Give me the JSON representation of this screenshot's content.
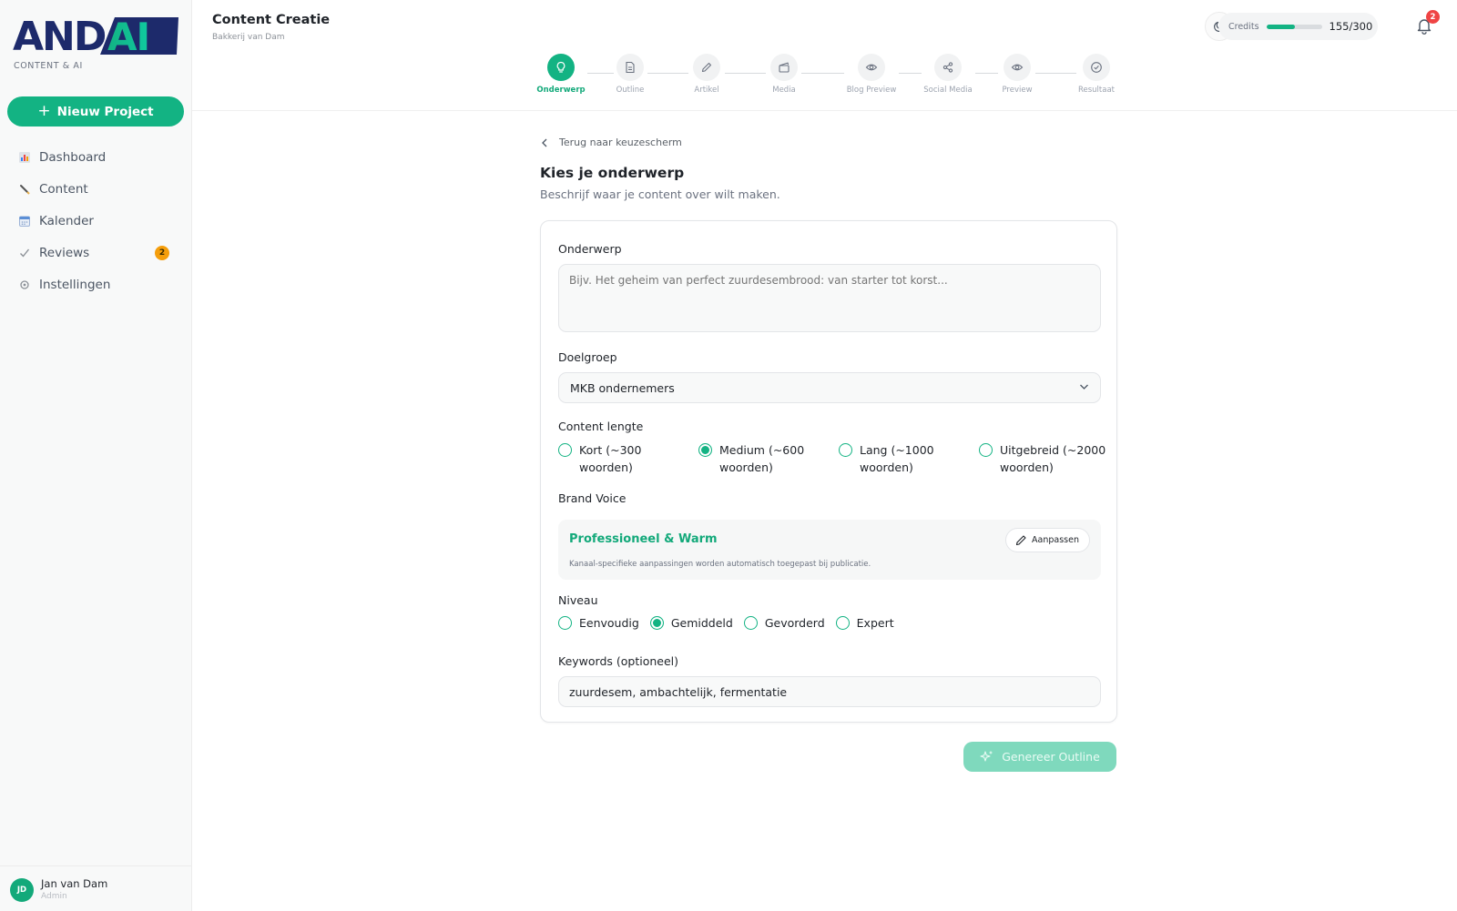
{
  "brand": {
    "logo_text": "ANDAI",
    "tagline": "CONTENT & AI",
    "accent": "#13b383"
  },
  "sidebar": {
    "new_project": "Nieuw Project",
    "items": [
      {
        "label": "Dashboard",
        "icon": "chart-icon"
      },
      {
        "label": "Content",
        "icon": "pencil-icon"
      },
      {
        "label": "Kalender",
        "icon": "calendar-icon"
      },
      {
        "label": "Reviews",
        "icon": "check-icon",
        "badge": "2"
      },
      {
        "label": "Instellingen",
        "icon": "gear-icon"
      }
    ],
    "user": {
      "initials": "JD",
      "name": "Jan van Dam",
      "role": "Admin"
    }
  },
  "header": {
    "title": "Content Creatie",
    "subtitle": "Bakkerij van Dam",
    "credits_label": "Credits",
    "credits_value": "155/300",
    "credits_fraction": 0.52,
    "notifications": "2"
  },
  "stepper": {
    "steps": [
      {
        "label": "Onderwerp",
        "icon": "lightbulb-icon",
        "active": true
      },
      {
        "label": "Outline",
        "icon": "document-icon"
      },
      {
        "label": "Artikel",
        "icon": "pen-icon"
      },
      {
        "label": "Media",
        "icon": "film-icon"
      },
      {
        "label": "Blog Preview",
        "icon": "eye-icon"
      },
      {
        "label": "Social Media",
        "icon": "share-icon"
      },
      {
        "label": "Preview",
        "icon": "eye-icon"
      },
      {
        "label": "Resultaat",
        "icon": "check-circle-icon"
      }
    ]
  },
  "main": {
    "back": "Terug naar keuzescherm",
    "title": "Kies je onderwerp",
    "subtitle": "Beschrijf waar je content over wilt maken.",
    "topic_label": "Onderwerp",
    "topic_placeholder": "Bijv. Het geheim van perfect zuurdesembrood: van starter tot korst...",
    "audience_label": "Doelgroep",
    "audience_value": "MKB ondernemers",
    "length_label": "Content lengte",
    "length_options": [
      {
        "line1": "Kort (~300",
        "line2": "woorden)"
      },
      {
        "line1": "Medium (~600",
        "line2": "woorden)",
        "checked": true
      },
      {
        "line1": "Lang (~1000",
        "line2": "woorden)"
      },
      {
        "line1": "Uitgebreid (~2000",
        "line2": "woorden)"
      }
    ],
    "voice_label": "Brand Voice",
    "voice_name": "Professioneel & Warm",
    "voice_edit": "Aanpassen",
    "voice_note": "Kanaal-specifieke aanpassingen worden automatisch toegepast bij publicatie.",
    "level_label": "Niveau",
    "level_options": [
      {
        "label": "Eenvoudig"
      },
      {
        "label": "Gemiddeld",
        "checked": true
      },
      {
        "label": "Gevorderd"
      },
      {
        "label": "Expert"
      }
    ],
    "keywords_label": "Keywords (optioneel)",
    "keywords_value": "zuurdesem, ambachtelijk, fermentatie",
    "generate": "Genereer Outline"
  }
}
